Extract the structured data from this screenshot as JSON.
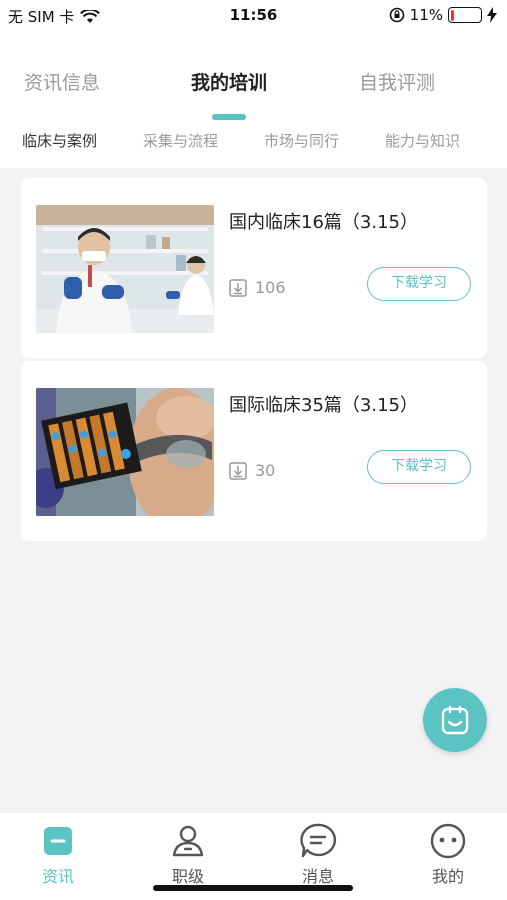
{
  "status_bar": {
    "carrier": "无 SIM 卡",
    "time": "11:56",
    "battery_percent": "11%",
    "battery_level": 0.11
  },
  "main_tabs": [
    {
      "label": "资讯信息",
      "active": false
    },
    {
      "label": "我的培训",
      "active": true
    },
    {
      "label": "自我评测",
      "active": false
    }
  ],
  "sub_tabs": [
    {
      "label": "临床与案例",
      "active": true
    },
    {
      "label": "采集与流程",
      "active": false
    },
    {
      "label": "市场与同行",
      "active": false
    },
    {
      "label": "能力与知识",
      "active": false
    }
  ],
  "cards": [
    {
      "title": "国内临床16篇（3.15）",
      "downloads": "106",
      "button_label": "下载学习",
      "thumbnail": "lab-scientist-photo"
    },
    {
      "title": "国际临床35篇（3.15）",
      "downloads": "30",
      "button_label": "下载学习",
      "thumbnail": "scientist-sample-plate-photo"
    }
  ],
  "bottom_nav": [
    {
      "label": "资讯",
      "icon": "news-icon",
      "active": true
    },
    {
      "label": "职级",
      "icon": "rank-user-icon",
      "active": false
    },
    {
      "label": "消息",
      "icon": "message-bubble-icon",
      "active": false
    },
    {
      "label": "我的",
      "icon": "profile-face-icon",
      "active": false
    }
  ],
  "colors": {
    "accent": "#5cc3c3",
    "battery_low": "#e53935",
    "background": "#f3f3f3"
  }
}
